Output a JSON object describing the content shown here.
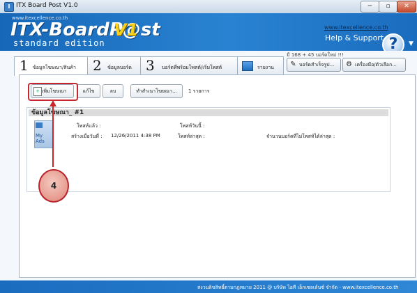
{
  "window": {
    "title": "ITX Board Post V1.0",
    "icon_glyph": "I",
    "min_glyph": "─",
    "max_glyph": "▫",
    "close_glyph": "✕"
  },
  "banner": {
    "small_url": "www.itexcellence.co.th",
    "brand": "ITX-BoardP@st",
    "version": "V1",
    "edition": "standard edition",
    "help_url": "www.itexcellence.co.th",
    "help_text": "Help & Support",
    "help_glyph": "?",
    "arrow_glyph": "▼"
  },
  "notice": "มี 168 + 45 บอร์ดใหม่ !!!",
  "tabs": [
    {
      "num": "1",
      "label": "ข้อมูลโฆษณา/สินค้า"
    },
    {
      "num": "2",
      "label": "ข้อมูลบอร์ด"
    },
    {
      "num": "3",
      "label": "บอร์ดที่พร้อมโพสต์/เริ่มโพสต์"
    },
    {
      "label": "รายงาน"
    }
  ],
  "top_buttons": {
    "success_board": "บอร์ดสำเร็จรูป...",
    "tools": "เครื่องมือ/ตัวเลือก..."
  },
  "toolbar": {
    "add": "เพิ่มโฆษณา",
    "edit": "แก้ไข",
    "delete": "ลบ",
    "copy": "ทำสำเนาโฆษณา...",
    "count": "1 รายการ"
  },
  "item": {
    "title": "ข้อมูลโฆษณา_ #1",
    "icon_label": "My Ads",
    "posted_label": "โพสท์แล้ว :",
    "posted_today_label": "โพสท์วันนี้ :",
    "created_label": "สร้างเมื่อวันที่ :",
    "created_value": "12/26/2011 4:38 PM",
    "last_post_label": "โพสท์ล่าสุด :",
    "unposted_label": "จำนวนบอร์ดที่ไม่โพสท์ได้ล่าสุด :"
  },
  "annotation": {
    "number": "4",
    "color": "#c6262c"
  },
  "footer": {
    "text": "สงวนลิขสิทธิ์ตามกฎหมาย 2011 @ บริษัท ไอที เอ็กเซลเล้นซ์ จำกัด - www.itexcellence.co.th"
  }
}
